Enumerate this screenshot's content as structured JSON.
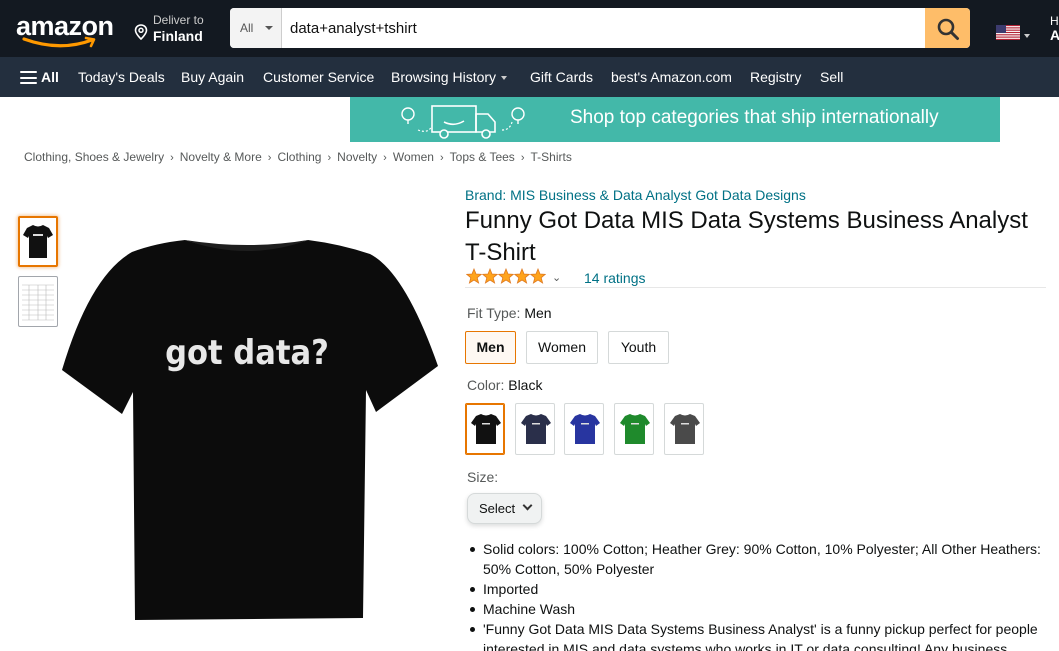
{
  "header": {
    "logo_text": "amazon",
    "deliver_line1": "Deliver to",
    "deliver_line2": "Finland",
    "search_category": "All",
    "search_value": "data+analyst+tshirt",
    "hello_line1": "H",
    "hello_line2": "A"
  },
  "nav": {
    "all_label": "All",
    "items": [
      {
        "label": "Today's Deals"
      },
      {
        "label": "Buy Again"
      },
      {
        "label": "Customer Service"
      },
      {
        "label": "Browsing History"
      },
      {
        "label": "Gift Cards"
      },
      {
        "label": "best's Amazon.com"
      },
      {
        "label": "Registry"
      },
      {
        "label": "Sell"
      }
    ]
  },
  "banner": {
    "text": "Shop top categories that ship internationally"
  },
  "breadcrumb": [
    "Clothing, Shoes & Jewelry",
    "Novelty & More",
    "Clothing",
    "Novelty",
    "Women",
    "Tops & Tees",
    "T-Shirts"
  ],
  "product": {
    "brand": "Brand: MIS Business & Data Analyst Got Data Designs",
    "title": "Funny Got Data MIS Data Systems Business Analyst T-Shirt",
    "rating_stars": 5,
    "ratings_count": "14 ratings",
    "shirt_text": "got data?",
    "fit_label": "Fit Type: ",
    "fit_value": "Men",
    "fit_options": [
      "Men",
      "Women",
      "Youth"
    ],
    "color_label": "Color: ",
    "color_value": "Black",
    "color_swatches": [
      "#111111",
      "#2a2f4a",
      "#2835a0",
      "#1f8a2c",
      "#4a4a4a"
    ],
    "size_label": "Size:",
    "size_select": "Select",
    "bullets": [
      "Solid colors: 100% Cotton; Heather Grey: 90% Cotton, 10% Polyester; All Other Heathers: 50% Cotton, 50% Polyester",
      "Imported",
      "Machine Wash",
      "'Funny Got Data MIS Data Systems Business Analyst' is a funny pickup perfect for people interested in MIS and data systems who works in IT or data consulting! Any business"
    ]
  },
  "colors": {
    "nav_dark": "#131921",
    "nav_sub": "#232f3e",
    "search_button": "#febd69",
    "link": "#007185",
    "banner": "#43b8a9",
    "selected_orange": "#e77600"
  }
}
